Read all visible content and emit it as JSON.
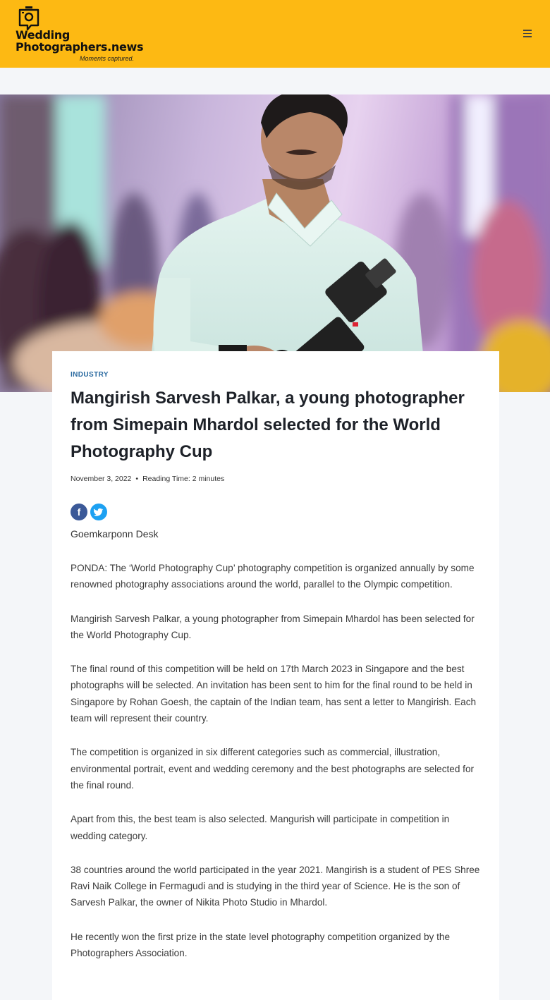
{
  "header": {
    "logo_line1": "Wedding",
    "logo_line2": "Photographers.news",
    "logo_tagline": "Moments captured.",
    "menu_icon": "hamburger-menu-icon",
    "background_color": "#fdb913"
  },
  "hero": {
    "image_description_icon": "photographer-with-camera-photo"
  },
  "article": {
    "category": "INDUSTRY",
    "title": "Mangirish Sarvesh Palkar, a young photographer from Simepain Mhardol selected for the World Photography Cup",
    "date": "November 3, 2022",
    "reading_time": "Reading Time: 2 minutes",
    "share": {
      "facebook_icon": "facebook-icon",
      "twitter_icon": "twitter-icon"
    },
    "author": "Goemkarponn Desk",
    "paragraphs": [
      "PONDA: The ‘World Photography Cup’ photography competition is organized annually by some renowned photography associations around the world, parallel to the Olympic competition.",
      "Mangirish Sarvesh Palkar, a young photographer from Simepain Mhardol has been selected for the World Photography Cup.",
      "The final round of this competition will be held on 17th March 2023 in Singapore and the best photographs will be selected. An invitation has been sent to him for the final round to be held in Singapore by Rohan Goesh, the captain of the Indian team, has sent a letter to Mangirish. Each team will represent their country.",
      "The competition is organized in six different categories such as commercial, illustration, environmental portrait, event and wedding ceremony and the best photographs are selected for the final round.",
      "Apart from this, the best team is also selected. Mangurish will participate in competition in wedding category.",
      "38 countries around the world participated in the year 2021. Mangirish is a student of PES Shree Ravi Naik College in Fermagudi and is studying in the third year of Science. He is the son of Sarvesh Palkar, the owner of Nikita Photo Studio in Mhardol.",
      "He recently won the first prize in the state level photography competition organized by the Photographers Association."
    ],
    "accent_color": "#2a6aa0"
  }
}
